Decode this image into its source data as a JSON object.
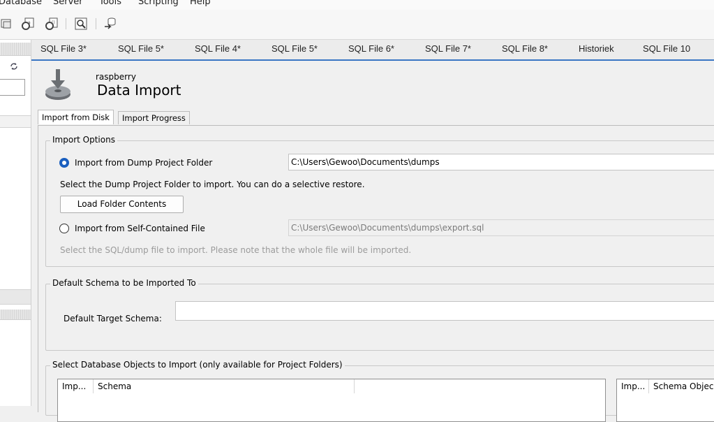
{
  "menu": {
    "items": [
      "Database",
      "Server",
      "Tools",
      "Scripting",
      "Help"
    ]
  },
  "toolbar": {
    "icons": [
      "new-connection-icon",
      "manage-connections-icon",
      "create-object-icon",
      "inspect-icon",
      "migration-icon"
    ]
  },
  "tabs": {
    "items": [
      "SQL File 3*",
      "SQL File 5*",
      "SQL File 4*",
      "SQL File 5*",
      "SQL File 6*",
      "SQL File 7*",
      "SQL File 8*",
      "Historiek",
      "SQL File 10"
    ]
  },
  "header": {
    "connection": "raspberry",
    "title": "Data Import"
  },
  "inner_tabs": {
    "disk": "Import from Disk",
    "progress": "Import Progress",
    "active": "Import from Disk"
  },
  "import_options": {
    "title": "Import Options",
    "folder_option": "Import from Dump Project Folder",
    "folder_path": "C:\\Users\\Gewoo\\Documents\\dumps",
    "folder_hint": "Select the Dump Project Folder to import. You can do a selective restore.",
    "load_button": "Load Folder Contents",
    "file_option": "Import from Self-Contained File",
    "file_path": "C:\\Users\\Gewoo\\Documents\\dumps\\export.sql",
    "file_hint": "Select the SQL/dump file to import. Please note that the whole file will be imported.",
    "selected": "folder"
  },
  "default_schema": {
    "title": "Default Schema to be Imported To",
    "label": "Default Target Schema:",
    "value": ""
  },
  "objects": {
    "title": "Select Database Objects to Import (only available for Project Folders)",
    "left_table": {
      "columns": [
        "Imp...",
        "Schema"
      ]
    },
    "right_table": {
      "columns": [
        "Imp...",
        "Schema Objec"
      ]
    }
  },
  "colors": {
    "accent": "#1a5fbf",
    "tab_underline": "#3a76c4"
  }
}
